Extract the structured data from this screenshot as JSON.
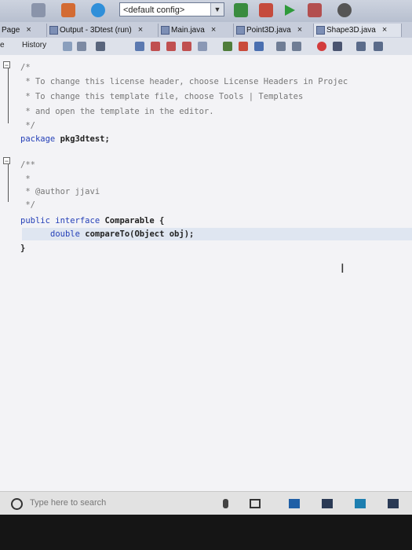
{
  "toolbar": {
    "config_value": "<default config>"
  },
  "tabs": [
    {
      "label": "Page"
    },
    {
      "label": "Output - 3Dtest (run)"
    },
    {
      "label": "Main.java"
    },
    {
      "label": "Point3D.java"
    },
    {
      "label": "Shape3D.java"
    }
  ],
  "editor_toolbar": {
    "source_label": "e",
    "history_label": "History"
  },
  "code": {
    "line1": "/*",
    "line2": " * To change this license header, choose License Headers in Projec",
    "line3": " * To change this template file, choose Tools | Templates",
    "line4": " * and open the template in the editor.",
    "line5": " */",
    "pkg_kw": "package",
    "pkg_name": " pkg3dtest;",
    "doc1": "/**",
    "doc2": " *",
    "doc3": " * @author jjavi",
    "doc4": " */",
    "iface_kw": "public interface",
    "iface_name": " Comparable {",
    "method_kw": "double",
    "method_name": " compareTo",
    "method_rest": "(Object obj);",
    "close": "}"
  },
  "taskbar": {
    "search_placeholder": "Type here to search"
  },
  "colors": {
    "keyword": "#2540b8",
    "comment": "#777777",
    "highlight": "#dfe6f1"
  }
}
